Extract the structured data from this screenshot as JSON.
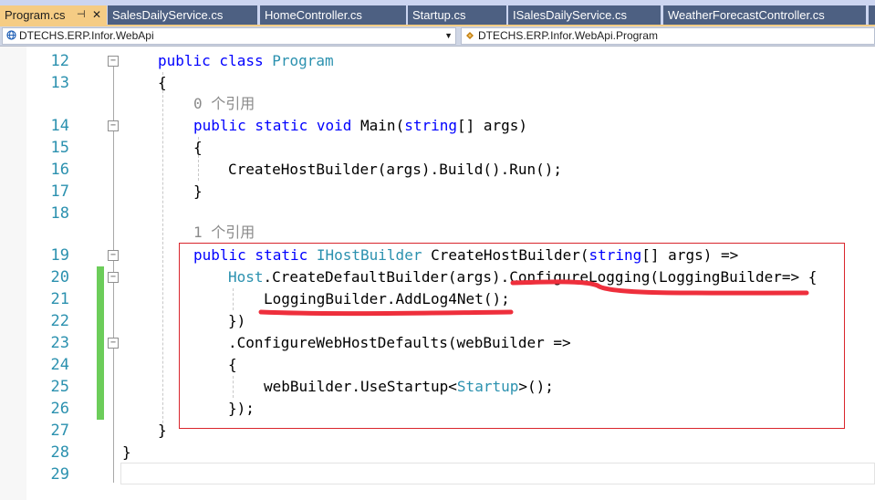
{
  "tabs": [
    {
      "label": "Program.cs",
      "active": true
    },
    {
      "label": "SalesDailyService.cs"
    },
    {
      "label": "HomeController.cs"
    },
    {
      "label": "Startup.cs"
    },
    {
      "label": "ISalesDailyService.cs"
    },
    {
      "label": "WeatherForecastController.cs"
    }
  ],
  "tab_tools": {
    "pin_icon": "⊣",
    "close_icon": "✕"
  },
  "navbar": {
    "project": "DTECHS.ERP.Infor.WebApi",
    "class_path": "DTECHS.ERP.Infor.WebApi.Program"
  },
  "editor": {
    "lines": [
      "12",
      "13",
      "14",
      "15",
      "16",
      "17",
      "18",
      "19",
      "20",
      "21",
      "22",
      "23",
      "24",
      "25",
      "26",
      "27",
      "28",
      "29"
    ],
    "codelens_refs": [
      "0 个引用",
      "1 个引用"
    ],
    "code": {
      "l12_kw": "public class ",
      "l12_ty": "Program",
      "l13": "{",
      "l14_kw": "public static void ",
      "l14_main": "Main(",
      "l14_kw2": "string",
      "l14_rest": "[] args)",
      "l15": "{",
      "l16": "CreateHostBuilder(args).Build().Run();",
      "l17": "}",
      "l19_kw": "public static ",
      "l19_ty": "IHostBuilder",
      "l19_name": " CreateHostBuilder(",
      "l19_kw2": "string",
      "l19_rest": "[] args) =>",
      "l20_ty": "Host",
      "l20_mid": ".CreateDefaultBuilder(args).ConfigureLogging(LoggingBuilder=> {",
      "l21": "LoggingBuilder.AddLog4Net();",
      "l22": "})",
      "l23": ".ConfigureWebHostDefaults(webBuilder =>",
      "l24": "{",
      "l25_a": "webBuilder.UseStartup<",
      "l25_ty": "Startup",
      "l25_b": ">();",
      "l26": "});",
      "l27": "}",
      "l28": "}"
    }
  },
  "colors": {
    "keyword": "#0000ff",
    "type": "#2b91af",
    "annotation": "#d9252c",
    "change_marker": "#6ccd5a"
  }
}
